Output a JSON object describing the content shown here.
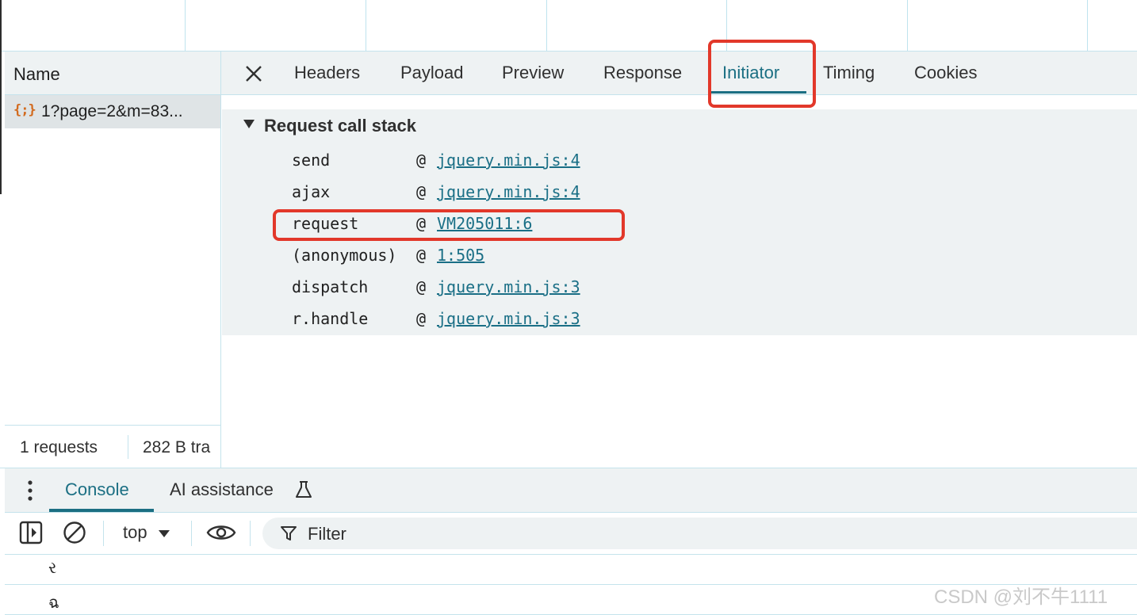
{
  "name_column": {
    "header": "Name",
    "request_icon": "{;}",
    "request_name": "1?page=2&m=83...",
    "summary_requests": "1 requests",
    "summary_transferred": "282 B tra"
  },
  "tabs": [
    "Headers",
    "Payload",
    "Preview",
    "Response",
    "Initiator",
    "Timing",
    "Cookies"
  ],
  "active_tab": "Initiator",
  "call_stack": {
    "title": "Request call stack",
    "frames": [
      {
        "fn": "send",
        "at": "@",
        "source": "jquery.min.js:4"
      },
      {
        "fn": "ajax",
        "at": "@",
        "source": "jquery.min.js:4"
      },
      {
        "fn": "request",
        "at": "@",
        "source": "VM205011:6"
      },
      {
        "fn": "(anonymous)",
        "at": "@",
        "source": "1:505"
      },
      {
        "fn": "dispatch",
        "at": "@",
        "source": "jquery.min.js:3"
      },
      {
        "fn": "r.handle",
        "at": "@",
        "source": "jquery.min.js:3"
      }
    ]
  },
  "drawer": {
    "tabs": [
      "Console",
      "AI assistance"
    ],
    "active": "Console",
    "context": "top",
    "filter_placeholder": "Filter",
    "lines": [
      "ર",
      "ฉ"
    ]
  },
  "watermark": "CSDN @刘不牛1111",
  "colors": {
    "accent": "#1b6f83",
    "highlight": "#e2382a",
    "panel_bg": "#eef2f3"
  }
}
